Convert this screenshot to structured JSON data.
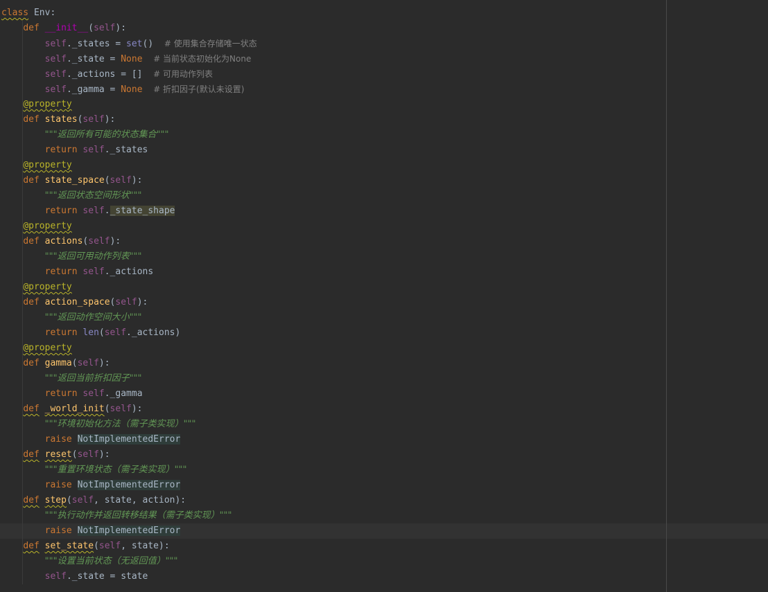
{
  "editor": {
    "language": "python",
    "class_name": "Env",
    "colors": {
      "background": "#2b2b2b",
      "keyword": "#cc7832",
      "function": "#ffc66d",
      "self": "#94558d",
      "decorator": "#bbb529",
      "docstring": "#629755",
      "comment": "#808080",
      "builtin": "#8888c6",
      "magic": "#b200b2"
    },
    "code": {
      "l1_kw": "class",
      "l1_name": " Env:",
      "init_def": "def",
      "init_name": "__init__",
      "self": "self",
      "l3_attr": "._states = ",
      "l3_set": "set",
      "l3_tail": "()",
      "l3_comment": "# 使用集合存储唯一状态",
      "l4_attr": "._state = ",
      "none": "None",
      "l4_comment": "# 当前状态初始化为None",
      "l5_attr": "._actions = []",
      "l5_comment": "# 可用动作列表",
      "l6_attr": "._gamma = ",
      "l6_comment": "# 折扣因子(默认未设置)",
      "decorator": "@property",
      "def": "def",
      "return": "return",
      "raise": "raise",
      "states_name": "states",
      "states_doc": "\"\"\"返回所有可能的状态集合\"\"\"",
      "states_ret": "._states",
      "state_space_name": "state_space",
      "state_space_doc": "\"\"\"返回状态空间形状\"\"\"",
      "state_space_ret": "_state_shape",
      "actions_name": "actions",
      "actions_doc": "\"\"\"返回可用动作列表\"\"\"",
      "actions_ret": "._actions",
      "action_space_name": "action_space",
      "action_space_doc": "\"\"\"返回动作空间大小\"\"\"",
      "len": "len",
      "action_space_ret": "._actions)",
      "gamma_name": "gamma",
      "gamma_doc": "\"\"\"返回当前折扣因子\"\"\"",
      "gamma_ret": "._gamma",
      "world_init_name": "_world_init",
      "world_init_doc": "\"\"\"环境初始化方法（需子类实现）\"\"\"",
      "not_impl": "NotImplementedError",
      "reset_name": "reset",
      "reset_doc": "\"\"\"重置环境状态（需子类实现）\"\"\"",
      "step_name": "step",
      "step_params": ", state, action",
      "step_doc": "\"\"\"执行动作并返回转移结果（需子类实现）\"\"\"",
      "set_state_name": "set_state",
      "set_state_params": ", state",
      "set_state_doc": "\"\"\"设置当前状态（无返回值）\"\"\"",
      "set_state_body": "._state = state"
    }
  }
}
